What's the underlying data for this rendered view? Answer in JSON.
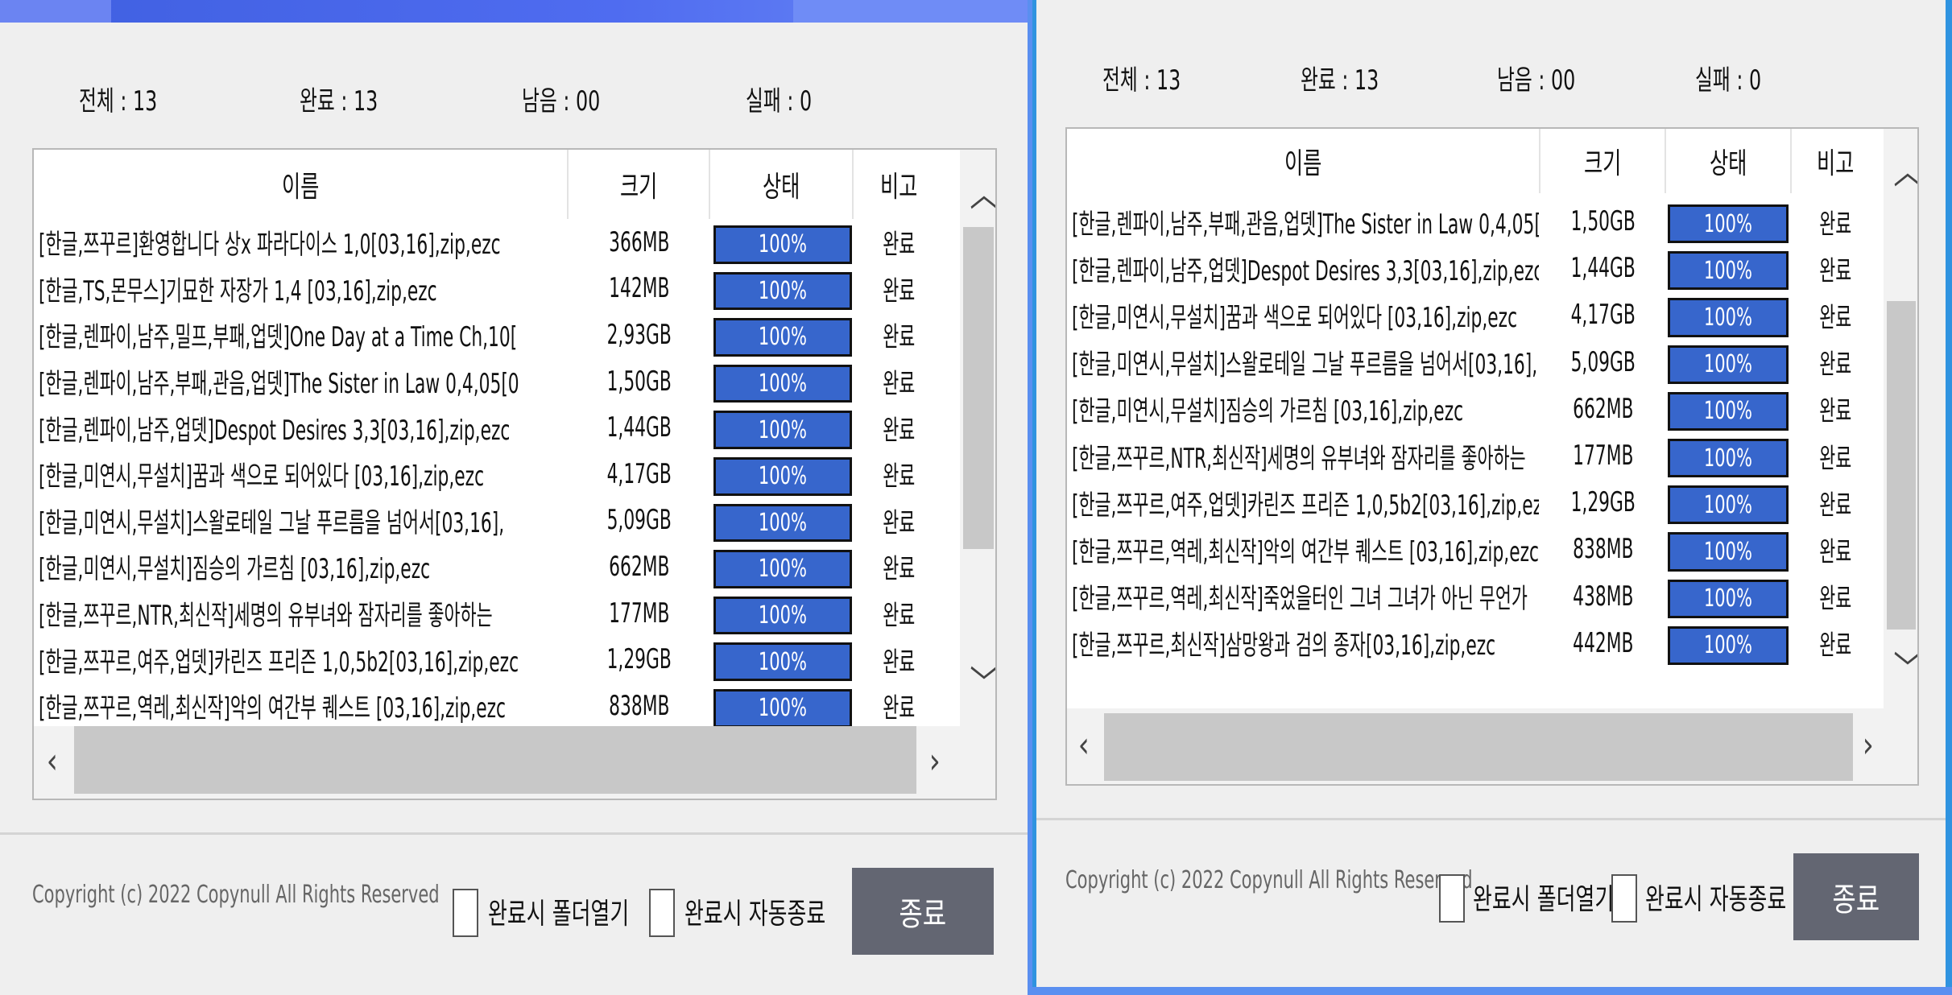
{
  "left_window": {
    "stats": {
      "total": "전체 : 13",
      "done": "완료 : 13",
      "remaining": "남음 : 00",
      "failed": "실패 : 0"
    },
    "columns": {
      "name": "이름",
      "size": "크기",
      "status": "상태",
      "note": "비고"
    },
    "rows": [
      {
        "name": "[한글,쯔꾸르]환영합니다 상x 파라다이스 1,0[03,16],zip,ezc",
        "size": "366MB",
        "status": "100%",
        "note": "완료"
      },
      {
        "name": "[한글,TS,몬무스]기묘한 자장가 1,4 [03,16],zip,ezc",
        "size": "142MB",
        "status": "100%",
        "note": "완료"
      },
      {
        "name": "[한글,렌파이,남주,밀프,부패,업뎃]One Day at a Time Ch,10[",
        "size": "2,93GB",
        "status": "100%",
        "note": "완료"
      },
      {
        "name": "[한글,렌파이,남주,부패,관음,업뎃]The Sister in Law 0,4,05[0",
        "size": "1,50GB",
        "status": "100%",
        "note": "완료"
      },
      {
        "name": "[한글,렌파이,남주,업뎃]Despot Desires 3,3[03,16],zip,ezc",
        "size": "1,44GB",
        "status": "100%",
        "note": "완료"
      },
      {
        "name": "[한글,미연시,무설치]꿈과 색으로 되어있다 [03,16],zip,ezc",
        "size": "4,17GB",
        "status": "100%",
        "note": "완료"
      },
      {
        "name": "[한글,미연시,무설치]스왈로테일 그날 푸르름을 넘어서[03,16],",
        "size": "5,09GB",
        "status": "100%",
        "note": "완료"
      },
      {
        "name": "[한글,미연시,무설치]짐승의 가르침 [03,16],zip,ezc",
        "size": "662MB",
        "status": "100%",
        "note": "완료"
      },
      {
        "name": "[한글,쯔꾸르,NTR,최신작]세명의 유부녀와 잠자리를 좋아하는",
        "size": "177MB",
        "status": "100%",
        "note": "완료"
      },
      {
        "name": "[한글,쯔꾸르,여주,업뎃]카린즈 프리즌 1,0,5b2[03,16],zip,ezc",
        "size": "1,29GB",
        "status": "100%",
        "note": "완료"
      },
      {
        "name": "[한글,쯔꾸르,역레,최신작]악의 여간부 퀘스트 [03,16],zip,ezc",
        "size": "838MB",
        "status": "100%",
        "note": "완료"
      }
    ],
    "footer": {
      "copyright": "Copyright (c) 2022 Copynull All Rights Reserved",
      "open_folder_label": "완료시 폴더열기",
      "auto_close_label": "완료시 자동종료",
      "close_button": "종료"
    }
  },
  "right_window": {
    "stats": {
      "total": "전체 : 13",
      "done": "완료 : 13",
      "remaining": "남음 : 00",
      "failed": "실패 : 0"
    },
    "columns": {
      "name": "이름",
      "size": "크기",
      "status": "상태",
      "note": "비고"
    },
    "rows": [
      {
        "name": "[한글,렌파이,남주,부패,관음,업뎃]The Sister in Law 0,4,05[0",
        "size": "1,50GB",
        "status": "100%",
        "note": "완료"
      },
      {
        "name": "[한글,렌파이,남주,업뎃]Despot Desires 3,3[03,16],zip,ezc",
        "size": "1,44GB",
        "status": "100%",
        "note": "완료"
      },
      {
        "name": "[한글,미연시,무설치]꿈과 색으로 되어있다 [03,16],zip,ezc",
        "size": "4,17GB",
        "status": "100%",
        "note": "완료"
      },
      {
        "name": "[한글,미연시,무설치]스왈로테일 그날 푸르름을 넘어서[03,16],",
        "size": "5,09GB",
        "status": "100%",
        "note": "완료"
      },
      {
        "name": "[한글,미연시,무설치]짐승의 가르침 [03,16],zip,ezc",
        "size": "662MB",
        "status": "100%",
        "note": "완료"
      },
      {
        "name": "[한글,쯔꾸르,NTR,최신작]세명의 유부녀와 잠자리를 좋아하는",
        "size": "177MB",
        "status": "100%",
        "note": "완료"
      },
      {
        "name": "[한글,쯔꾸르,여주,업뎃]카린즈 프리즌 1,0,5b2[03,16],zip,ezc",
        "size": "1,29GB",
        "status": "100%",
        "note": "완료"
      },
      {
        "name": "[한글,쯔꾸르,역레,최신작]악의 여간부 퀘스트 [03,16],zip,ezc",
        "size": "838MB",
        "status": "100%",
        "note": "완료"
      },
      {
        "name": "[한글,쯔꾸르,역레,최신작]죽었을터인 그녀 그녀가 아닌 무언가",
        "size": "438MB",
        "status": "100%",
        "note": "완료"
      },
      {
        "name": "[한글,쯔꾸르,최신작]삼망왕과 검의 종자[03,16],zip,ezc",
        "size": "442MB",
        "status": "100%",
        "note": "완료"
      }
    ],
    "footer": {
      "copyright": "Copyright (c) 2022 Copynull All Rights Reserved",
      "open_folder_label": "완료시 폴더열기",
      "auto_close_label": "완료시 자동종료",
      "close_button": "종료"
    }
  },
  "icons": {
    "scroll_up": "chevron-up-icon",
    "scroll_down": "chevron-down-icon",
    "scroll_left": "chevron-left-icon",
    "scroll_right": "chevron-right-icon"
  },
  "colors": {
    "progress_fill": "#3766cc",
    "close_button": "#636672",
    "window_border": "#2f93e0"
  }
}
